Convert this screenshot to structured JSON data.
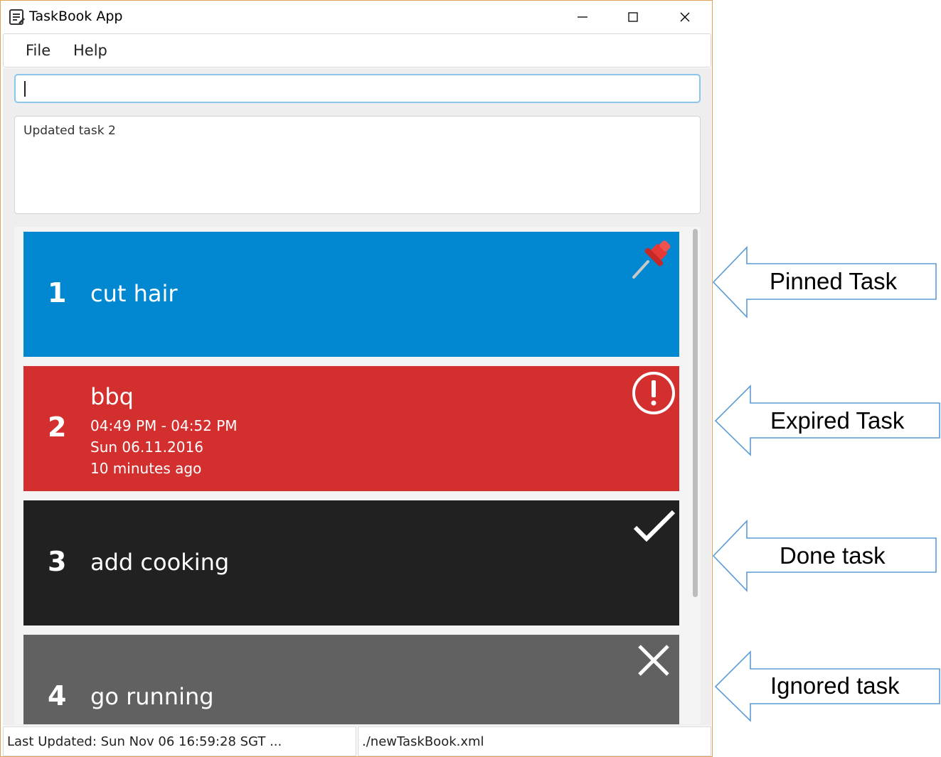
{
  "window": {
    "title": "TaskBook App",
    "icon": "task-list-icon",
    "controls": [
      "minimize-icon",
      "maximize-icon",
      "close-icon"
    ]
  },
  "menu": {
    "file": "File",
    "help": "Help"
  },
  "command": {
    "value": ""
  },
  "result": {
    "text": "Updated task 2"
  },
  "tasks": [
    {
      "index": "1",
      "name": "cut hair",
      "status": "pinned",
      "icon": "pushpin-icon",
      "color": "#0288d1"
    },
    {
      "index": "2",
      "name": "bbq",
      "time": "04:49 PM - 04:52 PM",
      "date": "Sun 06.11.2016",
      "relative": "10 minutes ago",
      "status": "expired",
      "icon": "exclamation-circle-icon",
      "color": "#d32f2f"
    },
    {
      "index": "3",
      "name": "add cooking",
      "status": "done",
      "icon": "checkmark-icon",
      "color": "#212121"
    },
    {
      "index": "4",
      "name": "go running",
      "status": "ignored",
      "icon": "cross-icon",
      "color": "#616161"
    }
  ],
  "status": {
    "last_updated": "Last Updated: Sun Nov 06 16:59:28 SGT ...",
    "file_path": "./newTaskBook.xml"
  },
  "annotations": {
    "pinned": "Pinned Task",
    "expired": "Expired Task",
    "done": "Done task",
    "ignored": "Ignored task",
    "arrow_color": "#5b9bd5"
  }
}
